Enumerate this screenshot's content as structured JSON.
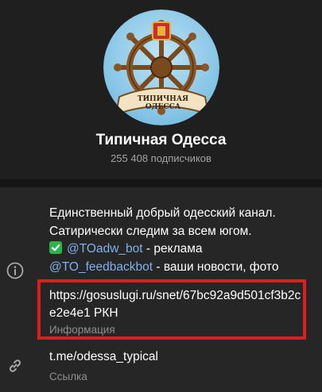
{
  "channel": {
    "title": "Типичная Одесса",
    "subscribers": "255 408 подписчиков",
    "avatar_icon": "ship-wheel-logo",
    "avatar_banner": "ТИПИЧНАЯ ОДЕССА"
  },
  "description": {
    "line1": "Единственный добрый одесский канал.",
    "line2": "Сатирически следим за всем югом.",
    "line3_emoji": "check-mark-emoji",
    "line3_mention": "@TOadw_bot",
    "line3_rest": " - реклама",
    "line4_mention": "@TO_feedbackbot",
    "line4_rest": " - ваши новости, фото"
  },
  "info_row": {
    "icon": "info-icon",
    "url": "https://gosuslugi.ru/snet/67bc92a9d501cf3b2ce2e4e1 РКН",
    "caption": "Информация"
  },
  "link_row": {
    "icon": "link-icon",
    "value": "t.me/odessa_typical",
    "caption": "Ссылка"
  },
  "colors": {
    "background": "#1f1f1f",
    "panel": "#262626",
    "mention": "#7fb0ee",
    "highlight": "#e11c1c",
    "secondary_text": "#8f8f8f"
  }
}
